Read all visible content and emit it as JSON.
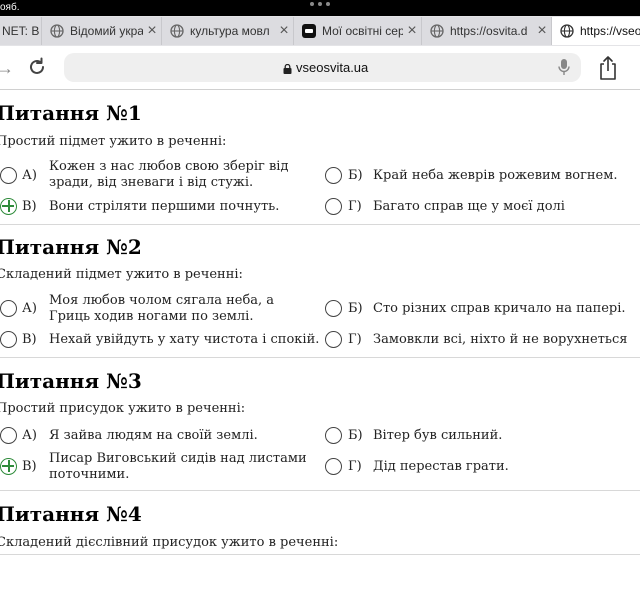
{
  "status_bar": {
    "day": "ояб."
  },
  "tabs": [
    {
      "title": "NET: B",
      "favicon": "globe-icon"
    },
    {
      "title": "Відомий украї",
      "favicon": "globe-icon"
    },
    {
      "title": "культура мовл",
      "favicon": "globe-icon"
    },
    {
      "title": "Мої освітні сер",
      "favicon": "site-logo-icon"
    },
    {
      "title": "https://osvita.d",
      "favicon": "globe-icon"
    },
    {
      "title": "https://vseo",
      "favicon": "globe-icon"
    }
  ],
  "address_bar": {
    "host": "vseosvita.ua"
  },
  "questions": [
    {
      "title": "Питання №1",
      "prompt": "Простий підмет ужито в реченні:",
      "options": [
        {
          "letter": "А)",
          "text": "Кожен з нас любов свою зберіг від зради, від зневаги і від стужі.",
          "correct": false
        },
        {
          "letter": "Б)",
          "text": "Край неба жеврів рожевим вогнем.",
          "correct": false
        },
        {
          "letter": "В)",
          "text": "Вони стріляти першими почнуть.",
          "correct": true
        },
        {
          "letter": "Г)",
          "text": "Багато справ ще у моєї долі",
          "correct": false
        }
      ]
    },
    {
      "title": "Питання №2",
      "prompt": "Складений підмет ужито в реченні:",
      "options": [
        {
          "letter": "А)",
          "text": "Моя любов чолом сягала неба, а Гриць ходив ногами по землі.",
          "correct": false
        },
        {
          "letter": "Б)",
          "text": "Сто різних справ кричало на папері.",
          "correct": false
        },
        {
          "letter": "В)",
          "text": "Нехай увійдуть у хату чистота і спокій.",
          "correct": false
        },
        {
          "letter": "Г)",
          "text": "Замовкли всі, ніхто й не ворухнеться",
          "correct": false
        }
      ]
    },
    {
      "title": "Питання №3",
      "prompt": "Простий присудок ужито в реченні:",
      "options": [
        {
          "letter": "А)",
          "text": "Я зайва людям на своїй землі.",
          "correct": false
        },
        {
          "letter": "Б)",
          "text": "Вітер був сильний.",
          "correct": false
        },
        {
          "letter": "В)",
          "text": "Писар Виговський сидів над листами поточними.",
          "correct": true
        },
        {
          "letter": "Г)",
          "text": "Дід перестав грати.",
          "correct": false
        }
      ]
    },
    {
      "title": "Питання №4",
      "prompt": "Складений дієслівний присудок ужито в реченні:",
      "options": []
    }
  ]
}
